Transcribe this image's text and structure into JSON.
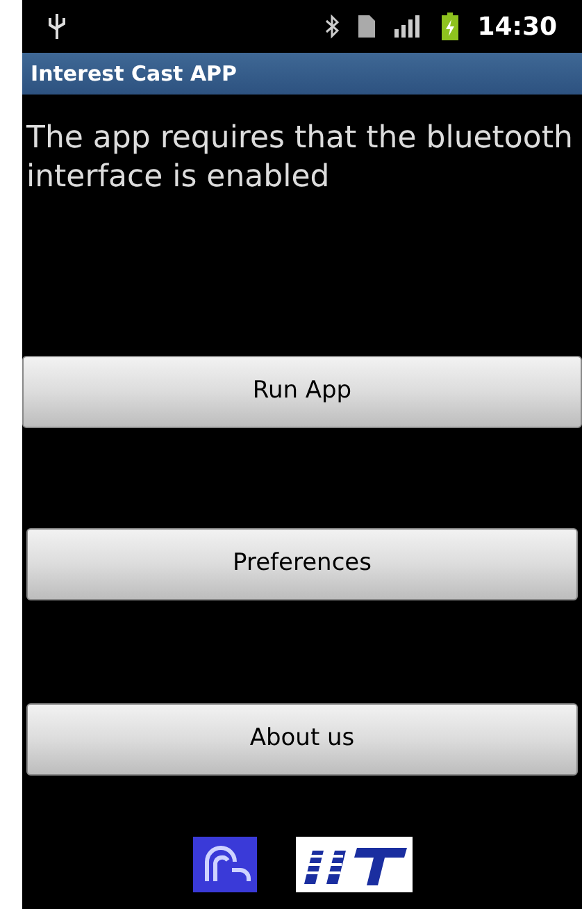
{
  "status_bar": {
    "time": "14:30"
  },
  "title_bar": {
    "title": "Interest Cast APP"
  },
  "message": "The app requires that the bluetooth interface is enabled",
  "buttons": [
    {
      "label": "Run App",
      "pressed": false
    },
    {
      "label": "Preferences",
      "pressed": false
    },
    {
      "label": "About us",
      "pressed": false
    }
  ]
}
